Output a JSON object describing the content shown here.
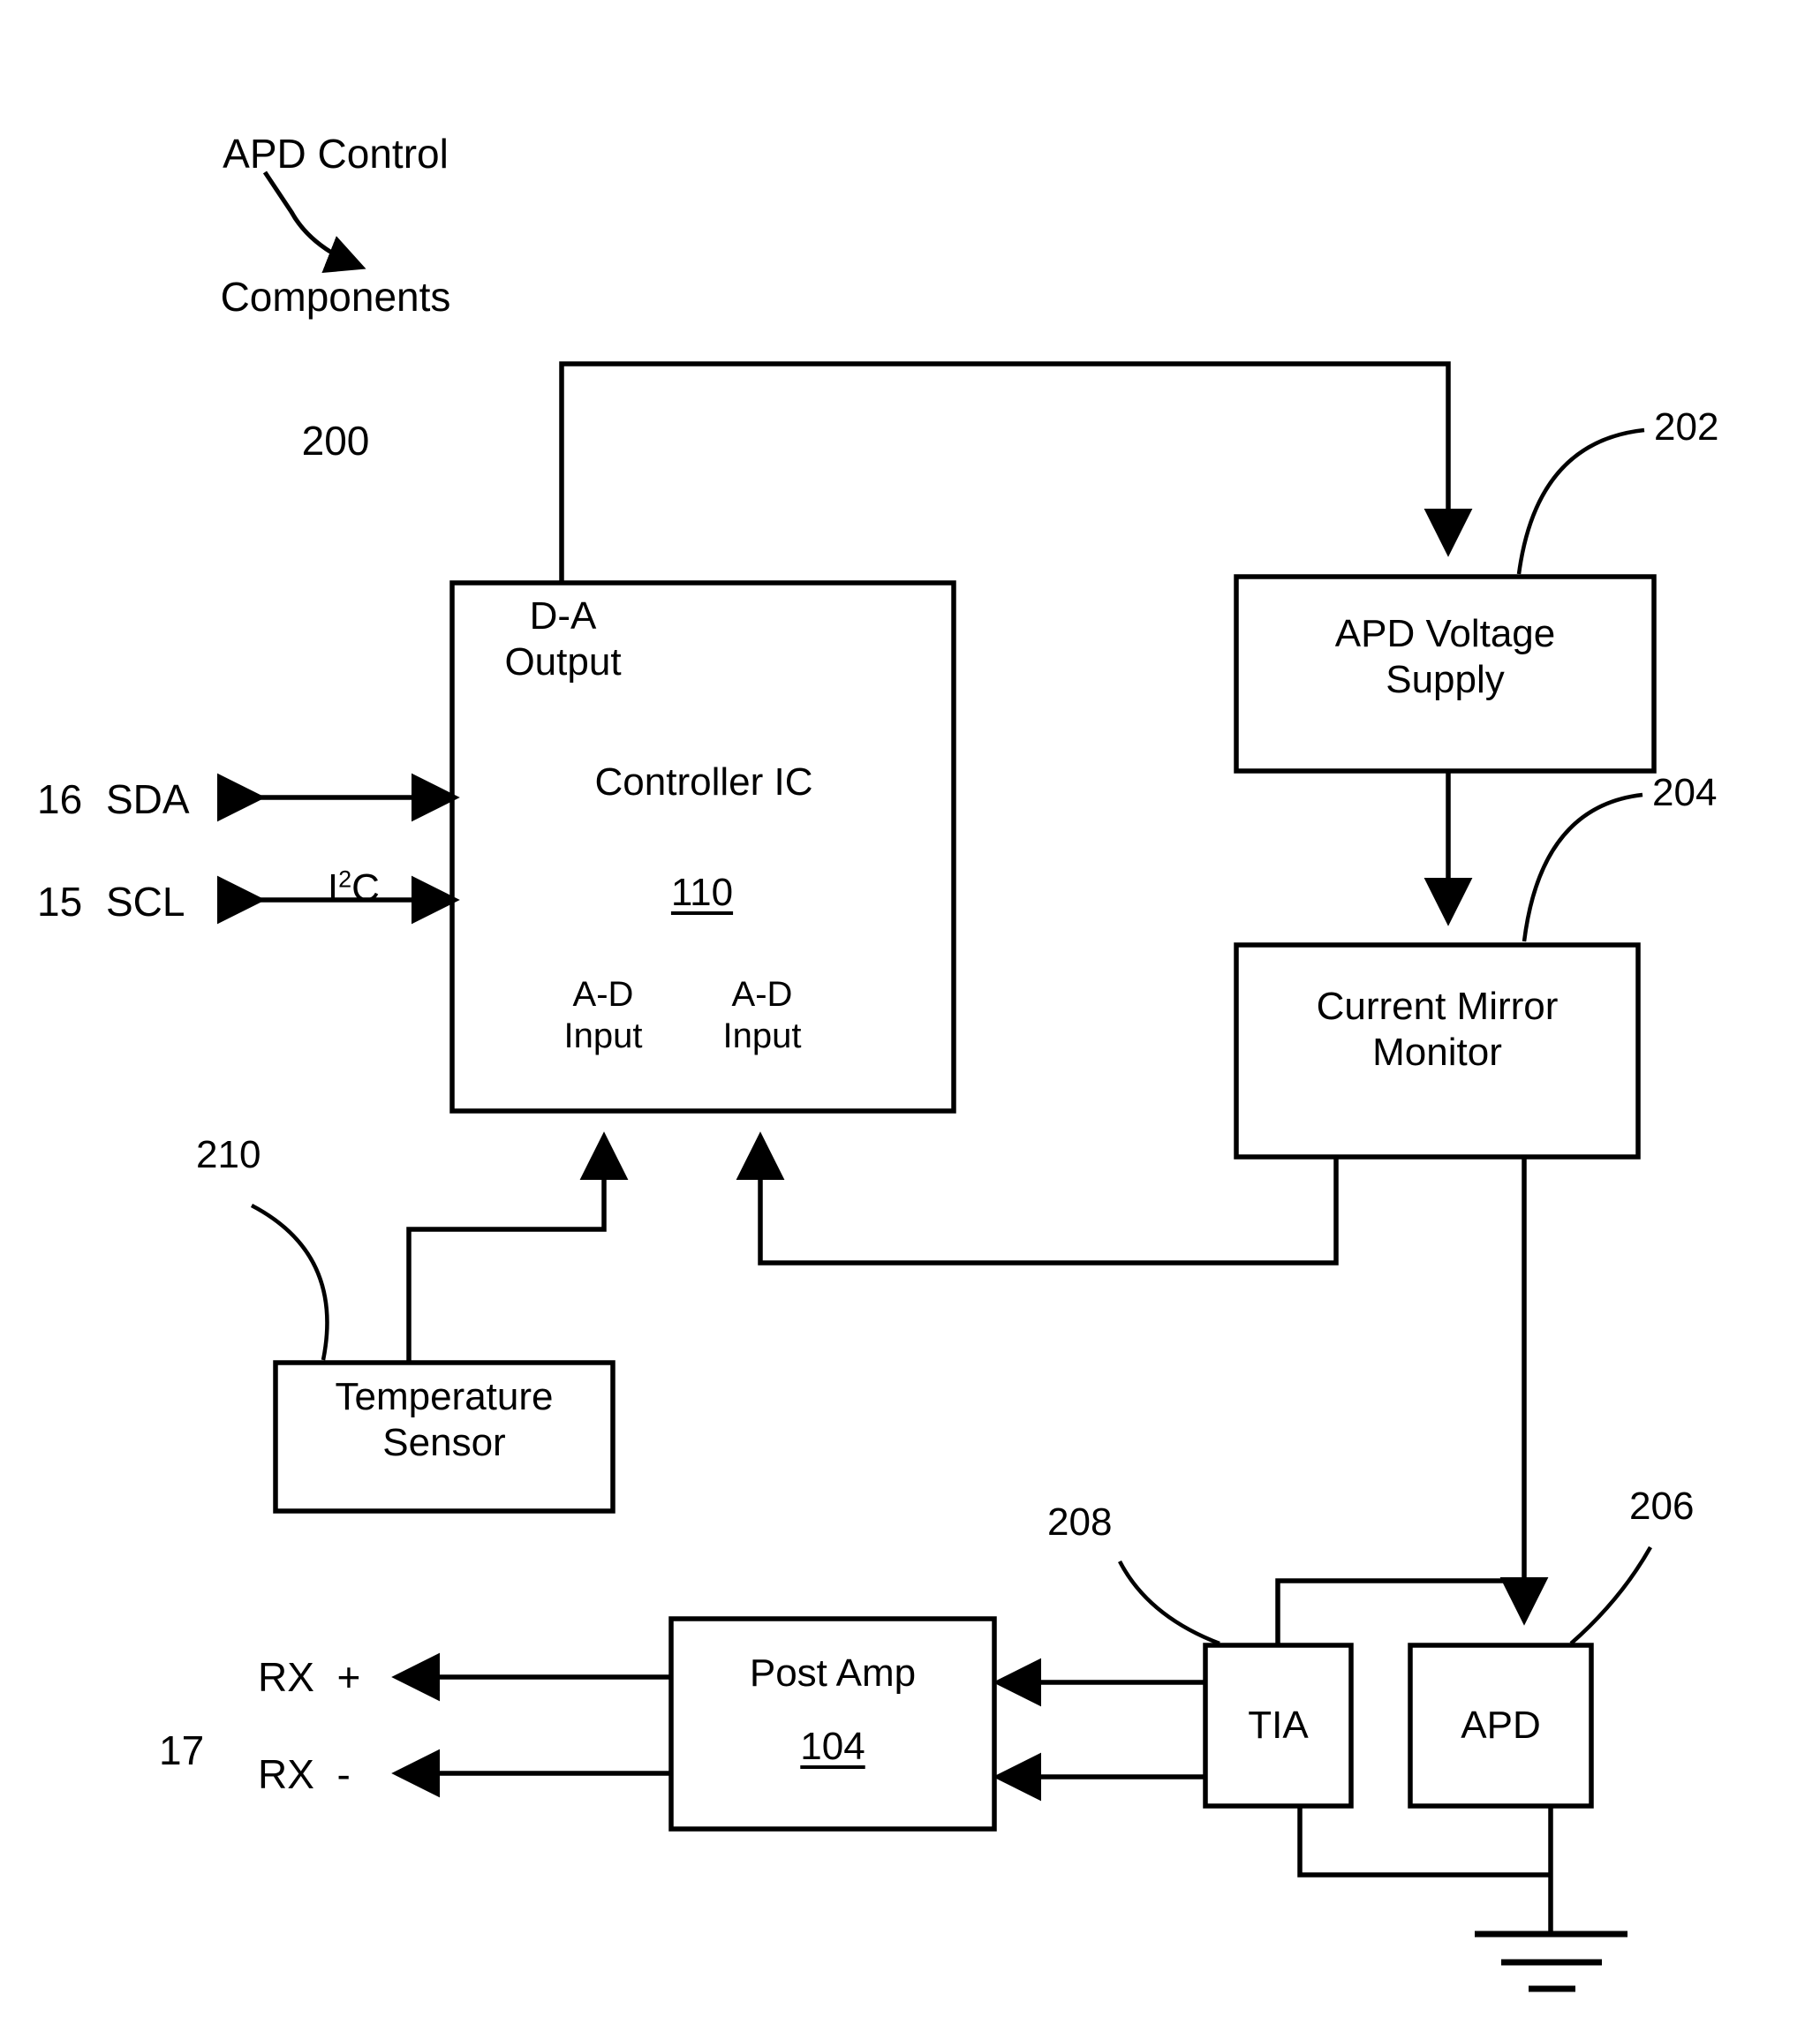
{
  "figure": {
    "title_lines": [
      "APD Control",
      "Components"
    ],
    "title_ref": "200"
  },
  "blocks": {
    "controller": {
      "da_output": "D-A\nOutput",
      "name": "Controller IC",
      "ref": "110",
      "ad_input_left": "A-D\nInput",
      "ad_input_right": "A-D\nInput"
    },
    "apd_voltage_supply": {
      "label": "APD Voltage\nSupply",
      "ref": "202"
    },
    "current_mirror_monitor": {
      "label": "Current Mirror\nMonitor",
      "ref": "204"
    },
    "temperature_sensor": {
      "label": "Temperature\nSensor",
      "ref": "210"
    },
    "post_amp": {
      "label": "Post Amp",
      "ref": "104"
    },
    "tia": {
      "label": "TIA",
      "ref": "208"
    },
    "apd": {
      "label": "APD",
      "ref": "206"
    }
  },
  "signals": {
    "sda_number": "16",
    "sda_label": "SDA",
    "scl_number": "15",
    "scl_label": "SCL",
    "bus_label_pre": "I",
    "bus_label_sup": "2",
    "bus_label_post": "C",
    "rx_group_number": "17",
    "rx_plus": "RX  +",
    "rx_minus": "RX  -"
  },
  "icons": {
    "ground": "ground-symbol",
    "arrow": "arrowhead"
  },
  "colors": {
    "ink": "#000000",
    "paper": "#ffffff"
  }
}
